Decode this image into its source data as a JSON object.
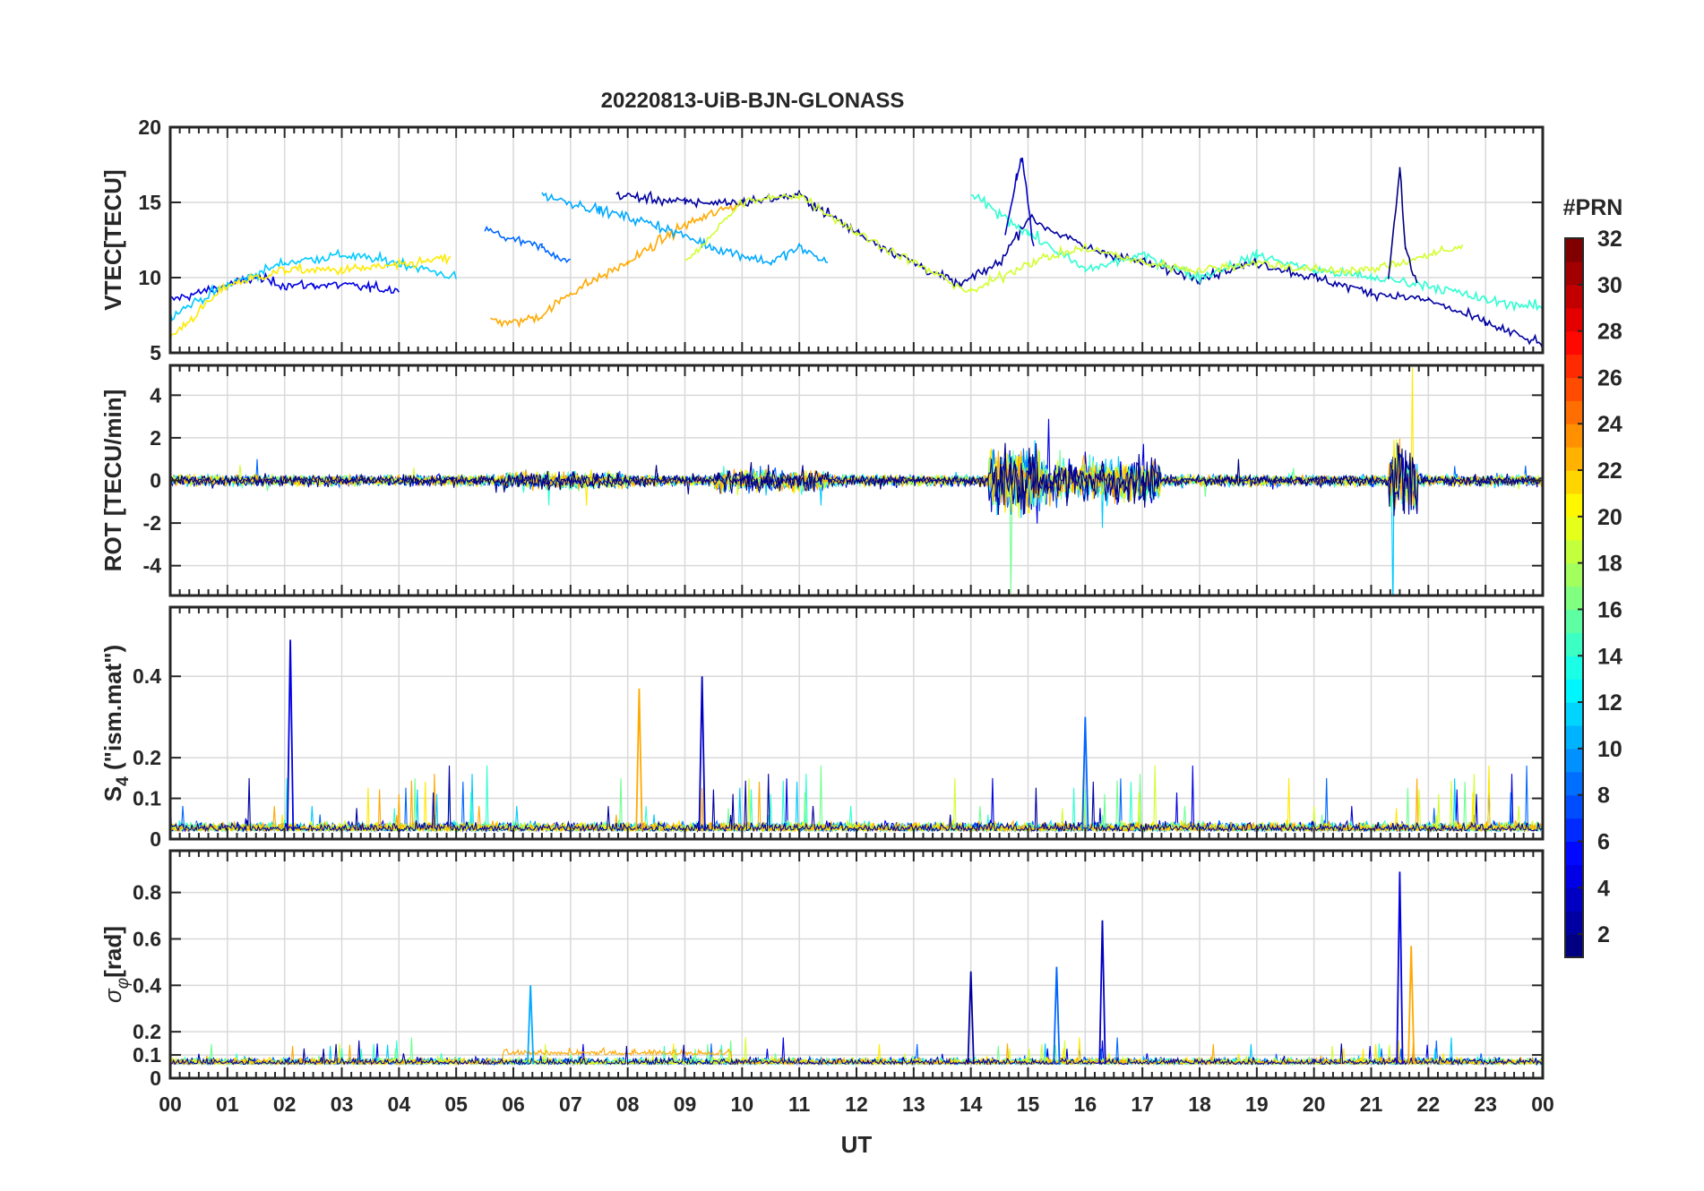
{
  "title": "20220813-UiB-BJN-GLONASS",
  "chart_data": [
    {
      "type": "line",
      "ylabel": "VTEC[TECU]",
      "ylim": [
        5,
        20
      ],
      "yticks": [
        5,
        10,
        15,
        20
      ],
      "description_of_data": "Many PRN series of vertical TEC varying between about 5 and 18 TECU; peak near 14.9 UT (~18) and 21.5 UT (~17.5)",
      "series": [
        {
          "prn": 4,
          "x": [
            0,
            0.5,
            1,
            1.5,
            2,
            2.5,
            3,
            3.5,
            4
          ],
          "y": [
            8.5,
            9,
            9.5,
            10,
            9.5,
            9.5,
            9.5,
            9.3,
            9.2
          ]
        },
        {
          "prn": 11,
          "x": [
            0,
            1,
            2,
            3,
            4,
            5
          ],
          "y": [
            7.5,
            9.5,
            11,
            11.5,
            11,
            10
          ]
        },
        {
          "prn": 21,
          "x": [
            0,
            1,
            2,
            3,
            4,
            4.9
          ],
          "y": [
            6,
            9.5,
            10.5,
            10.5,
            10.8,
            11.3
          ]
        },
        {
          "prn": 8,
          "x": [
            5.5,
            6,
            6.5,
            7
          ],
          "y": [
            13.2,
            12.5,
            12,
            11
          ]
        },
        {
          "prn": 23,
          "x": [
            5.6,
            6,
            6.5,
            7,
            8,
            9,
            10
          ],
          "y": [
            7.2,
            7,
            7.5,
            9,
            11,
            13.5,
            15
          ]
        },
        {
          "prn": 10,
          "x": [
            6.5,
            7.5,
            8.5,
            9.5,
            10.5,
            11,
            11.5
          ],
          "y": [
            15.5,
            14.5,
            13.5,
            12,
            11,
            12,
            11
          ]
        },
        {
          "prn": 2,
          "x": [
            7.8,
            9,
            10,
            11,
            12,
            13,
            13.8,
            14.5,
            15,
            16,
            17,
            18,
            19,
            20,
            21,
            22,
            23,
            24
          ],
          "y": [
            15.5,
            15,
            15,
            15.5,
            13,
            11,
            9.5,
            11,
            14,
            12,
            11,
            10,
            11,
            10,
            9,
            8.5,
            7,
            5.5
          ]
        },
        {
          "prn": 14,
          "x": [
            14,
            15,
            16,
            17,
            18,
            19,
            20,
            21,
            22,
            23,
            24
          ],
          "y": [
            15.5,
            13,
            10.5,
            11.5,
            10,
            11.5,
            10.5,
            10,
            9.5,
            8.5,
            8
          ]
        },
        {
          "prn": 19,
          "x": [
            9,
            10,
            11,
            12,
            13,
            14,
            15,
            16,
            17,
            18,
            19,
            20,
            21,
            22,
            22.6
          ],
          "y": [
            11,
            15,
            15.5,
            13,
            11,
            9,
            11,
            12,
            11,
            10.5,
            11,
            10.5,
            10.5,
            11.5,
            12
          ]
        },
        {
          "prn": 1,
          "x": [
            21.3,
            21.5,
            21.6,
            21.8
          ],
          "y": [
            10,
            17.3,
            12,
            9.5
          ]
        },
        {
          "prn": 3,
          "x": [
            14.6,
            14.8,
            14.9,
            15.1
          ],
          "y": [
            13,
            16.5,
            18,
            12
          ]
        }
      ]
    },
    {
      "type": "line",
      "ylabel": "ROT [TECU/min]",
      "ylim": [
        -5.4,
        5.4
      ],
      "yticks": [
        -4,
        -2,
        0,
        2,
        4
      ],
      "description_of_data": "Rate of TEC fluctuating near 0, with large spikes up to about ±5 near 14.8 UT and 21.5 UT"
    },
    {
      "type": "line",
      "ylabel": "S4 (\"ism.mat\")",
      "ylabel_main": "S",
      "ylabel_sub": "4",
      "ylabel_rest": " (\"ism.mat\")",
      "ylim": [
        0,
        0.57
      ],
      "yticks": [
        0,
        0.1,
        0.2,
        0.4
      ],
      "peaks": [
        {
          "x": 2.1,
          "y": 0.49
        },
        {
          "x": 9.3,
          "y": 0.4
        },
        {
          "x": 8.2,
          "y": 0.37
        },
        {
          "x": 16,
          "y": 0.3
        }
      ]
    },
    {
      "type": "line",
      "ylabel": "σφ[rad]",
      "ylabel_main": "σ",
      "ylabel_sub": "φ",
      "ylabel_rest": "[rad]",
      "ylim": [
        0,
        0.98
      ],
      "yticks": [
        0,
        0.1,
        0.2,
        0.4,
        0.6,
        0.8
      ],
      "peaks": [
        {
          "x": 21.5,
          "y": 0.89
        },
        {
          "x": 16.3,
          "y": 0.68
        },
        {
          "x": 21.7,
          "y": 0.57
        },
        {
          "x": 15.5,
          "y": 0.48
        },
        {
          "x": 14,
          "y": 0.46
        },
        {
          "x": 6.3,
          "y": 0.4
        }
      ]
    }
  ],
  "xaxis": {
    "label": "UT",
    "ticks": [
      "00",
      "01",
      "02",
      "03",
      "04",
      "05",
      "06",
      "07",
      "08",
      "09",
      "10",
      "11",
      "12",
      "13",
      "14",
      "15",
      "16",
      "17",
      "18",
      "19",
      "20",
      "21",
      "22",
      "23",
      "00"
    ],
    "xlim": [
      0,
      24
    ]
  },
  "colorbar": {
    "label": "#PRN",
    "ticks": [
      "2",
      "4",
      "6",
      "8",
      "10",
      "12",
      "14",
      "16",
      "18",
      "20",
      "22",
      "24",
      "26",
      "28",
      "30",
      "32"
    ],
    "range": [
      1,
      32
    ],
    "colormap": "jet"
  }
}
